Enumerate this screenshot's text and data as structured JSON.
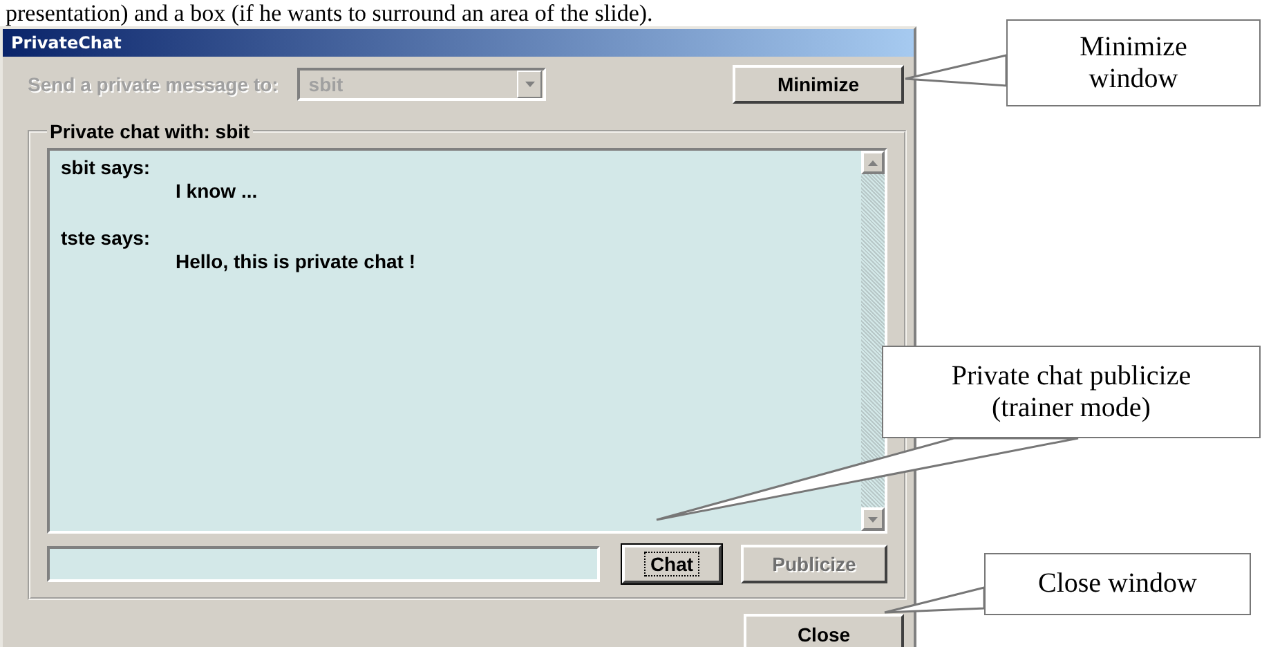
{
  "caption": "presentation) and a box (if he wants to surround an area of the slide).",
  "window": {
    "title": "PrivateChat"
  },
  "recipient": {
    "label": "Send a private message to:",
    "value": "sbit",
    "disabled": true
  },
  "minimize_button": {
    "label": "Minimize"
  },
  "chat_group": {
    "title": "Private chat with: sbit",
    "messages": [
      {
        "sender": "sbit says:",
        "text": "I know ..."
      },
      {
        "sender": "tste says:",
        "text": "Hello, this is private chat !"
      }
    ]
  },
  "buttons": [
    {
      "label": "Chat",
      "disabled": false,
      "focused": true
    },
    {
      "label": "Publicize",
      "disabled": true,
      "focused": false
    }
  ],
  "close_button": {
    "label": "Close"
  },
  "callouts": [
    {
      "text": "Minimize\nwindow"
    },
    {
      "text": "Private chat publicize\n(trainer mode)"
    },
    {
      "text": "Close window"
    }
  ]
}
